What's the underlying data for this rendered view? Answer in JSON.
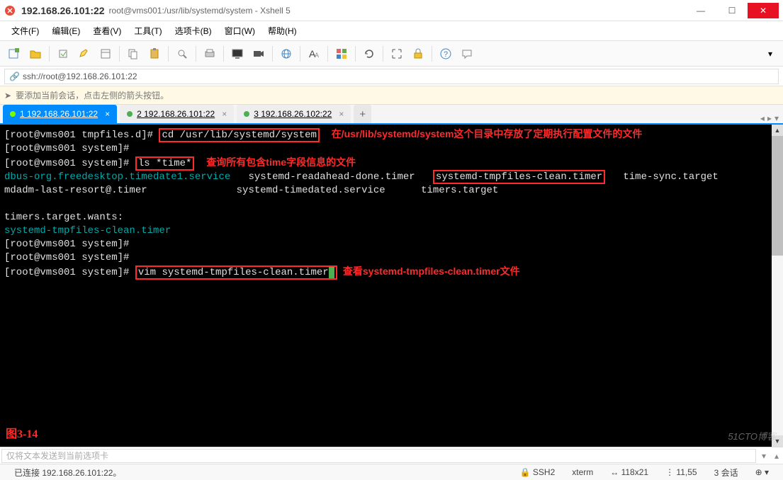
{
  "titlebar": {
    "host": "192.168.26.101:22",
    "path": "root@vms001:/usr/lib/systemd/system - Xshell 5"
  },
  "menu": [
    "文件(F)",
    "编辑(E)",
    "查看(V)",
    "工具(T)",
    "选项卡(B)",
    "窗口(W)",
    "帮助(H)"
  ],
  "addressbar": "ssh://root@192.168.26.101:22",
  "hint": "要添加当前会话，点击左侧的箭头按钮。",
  "tabs": [
    {
      "label": "1 192.168.26.101:22",
      "active": true
    },
    {
      "label": "2 192.168.26.101:22",
      "active": false
    },
    {
      "label": "3 192.168.26.102:22",
      "active": false
    }
  ],
  "terminal": {
    "line1_prompt": "[root@vms001 tmpfiles.d]# ",
    "line1_cmd": "cd /usr/lib/systemd/system",
    "line1_note": "在/usr/lib/systemd/system这个目录中存放了定期执行配置文件的文件",
    "line2": "[root@vms001 system]#",
    "line3_prompt": "[root@vms001 system]# ",
    "line3_cmd": "ls *time*",
    "line3_note": "查询所有包含time字段信息的文件",
    "line4_a": "dbus-org.freedesktop.timedate1.service",
    "line4_b": "   systemd-readahead-done.timer   ",
    "line4_c": "systemd-tmpfiles-clean.timer",
    "line4_d": "   time-sync.target",
    "line5": "mdadm-last-resort@.timer               systemd-timedated.service      timers.target",
    "line6": "",
    "line7": "timers.target.wants:",
    "line8": "systemd-tmpfiles-clean.timer",
    "line9": "[root@vms001 system]#",
    "line10": "[root@vms001 system]#",
    "line11_prompt": "[root@vms001 system]# ",
    "line11_cmd": "vim systemd-tmpfiles-clean.timer",
    "line11_note": "  查看systemd-tmpfiles-clean.timer文件"
  },
  "figure_label": "图3-14",
  "watermark": "51CTO博客",
  "inputline_placeholder": "仅将文本发送到当前选项卡",
  "statusbar": {
    "left": "已连接 192.168.26.101:22。",
    "ssh": "SSH2",
    "term": "xterm",
    "size": "118x21",
    "pos": "11,55",
    "sessions": "3 会话"
  }
}
